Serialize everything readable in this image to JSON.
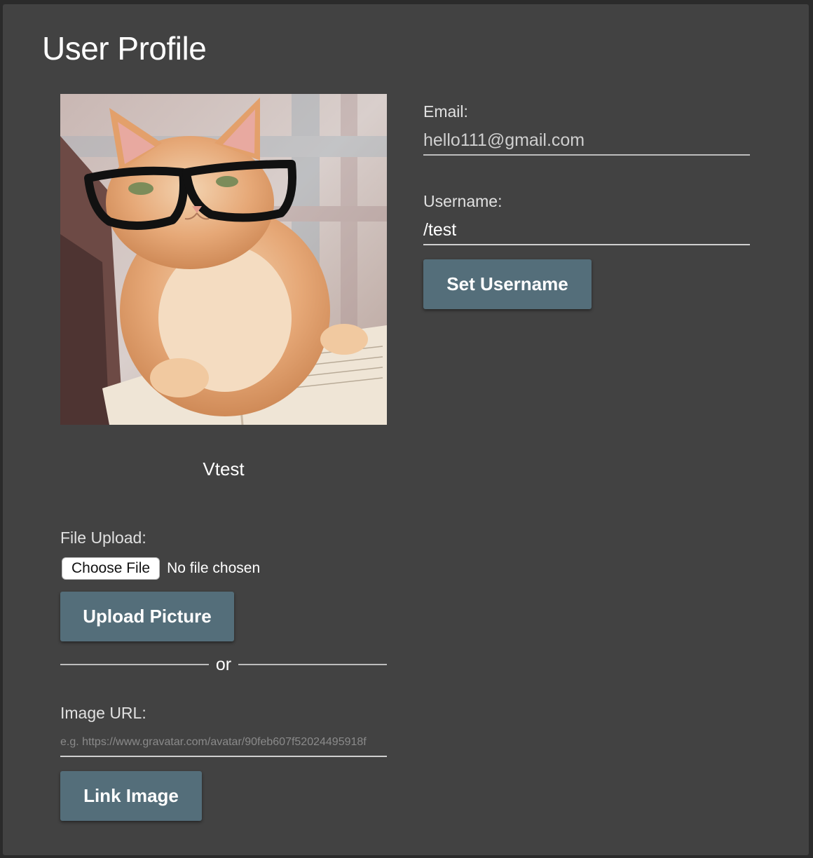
{
  "page": {
    "title": "User Profile"
  },
  "profile": {
    "display_name": "Vtest",
    "avatar_alt": "cat wearing glasses reading a book"
  },
  "email": {
    "label": "Email:",
    "value": "hello111@gmail.com"
  },
  "username": {
    "label": "Username:",
    "value": "/test",
    "button_label": "Set Username"
  },
  "upload": {
    "label": "File Upload:",
    "choose_file_label": "Choose File",
    "status_text": "No file chosen",
    "button_label": "Upload Picture"
  },
  "divider": {
    "text": "or"
  },
  "image_url": {
    "label": "Image URL:",
    "value": "",
    "placeholder": "e.g. https://www.gravatar.com/avatar/90feb607f52024495918f",
    "button_label": "Link Image"
  },
  "colors": {
    "panel_background": "#424242",
    "button_background": "#546e7a",
    "text": "#ffffff"
  }
}
